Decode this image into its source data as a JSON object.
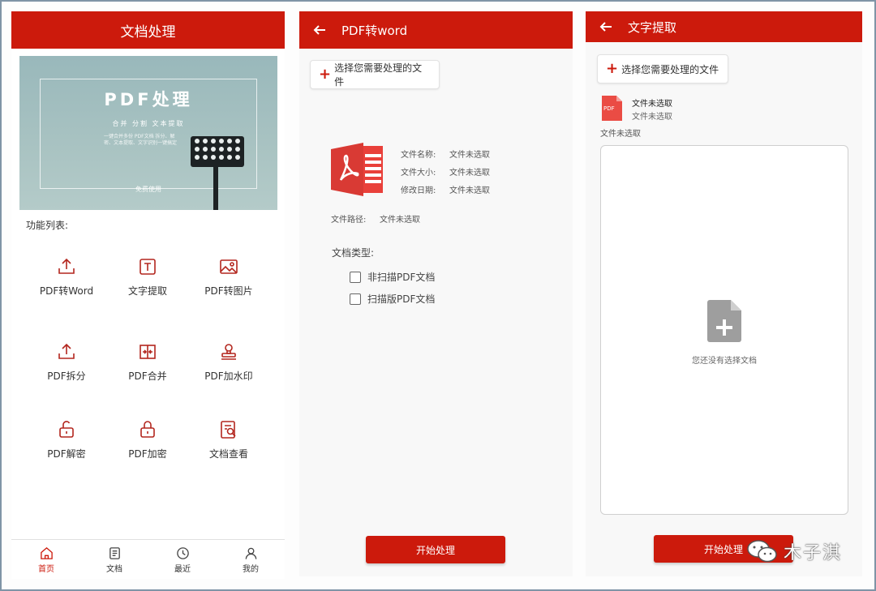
{
  "screen1": {
    "title": "文档处理",
    "banner": {
      "title": "PDF处理",
      "subtitle": "合并  分割  文本提取",
      "tiny_text": "一键合并多份 PDF文档 拆分、解密、文本提取、文字识别一键搞定",
      "footer": "免费使用"
    },
    "section_label": "功能列表:",
    "features": [
      {
        "label": "PDF转Word",
        "icon": "upload-icon"
      },
      {
        "label": "文字提取",
        "icon": "text-icon"
      },
      {
        "label": "PDF转图片",
        "icon": "image-icon"
      },
      {
        "label": "PDF拆分",
        "icon": "split-icon"
      },
      {
        "label": "PDF合并",
        "icon": "merge-icon"
      },
      {
        "label": "PDF加水印",
        "icon": "stamp-icon"
      },
      {
        "label": "PDF解密",
        "icon": "unlock-icon"
      },
      {
        "label": "PDF加密",
        "icon": "lock-icon"
      },
      {
        "label": "文档查看",
        "icon": "doc-search-icon"
      }
    ],
    "nav": [
      {
        "label": "首页",
        "icon": "home-icon",
        "active": true
      },
      {
        "label": "文档",
        "icon": "document-icon",
        "active": false
      },
      {
        "label": "最近",
        "icon": "clock-icon",
        "active": false
      },
      {
        "label": "我的",
        "icon": "user-icon",
        "active": false
      }
    ]
  },
  "screen2": {
    "title": "PDF转word",
    "pick_button": "选择您需要处理的文件",
    "file_name_label": "文件名称:",
    "file_name_value": "文件未选取",
    "file_size_label": "文件大小:",
    "file_size_value": "文件未选取",
    "modified_label": "修改日期:",
    "modified_value": "文件未选取",
    "path_label": "文件路径:",
    "path_value": "文件未选取",
    "doc_type_label": "文档类型:",
    "option_non_scan": "非扫描PDF文档",
    "option_scan": "扫描版PDF文档",
    "start_button": "开始处理"
  },
  "screen3": {
    "title": "文字提取",
    "pick_button": "选择您需要处理的文件",
    "pdf_badge": "PDF",
    "file_line1": "文件未选取",
    "file_line2": "文件未选取",
    "file_status": "文件未选取",
    "empty_text": "您还没有选择文档",
    "start_button": "开始处理"
  },
  "watermark": "木子淇",
  "colors": {
    "accent": "#cc1a0c",
    "background": "#f8f8f8"
  }
}
